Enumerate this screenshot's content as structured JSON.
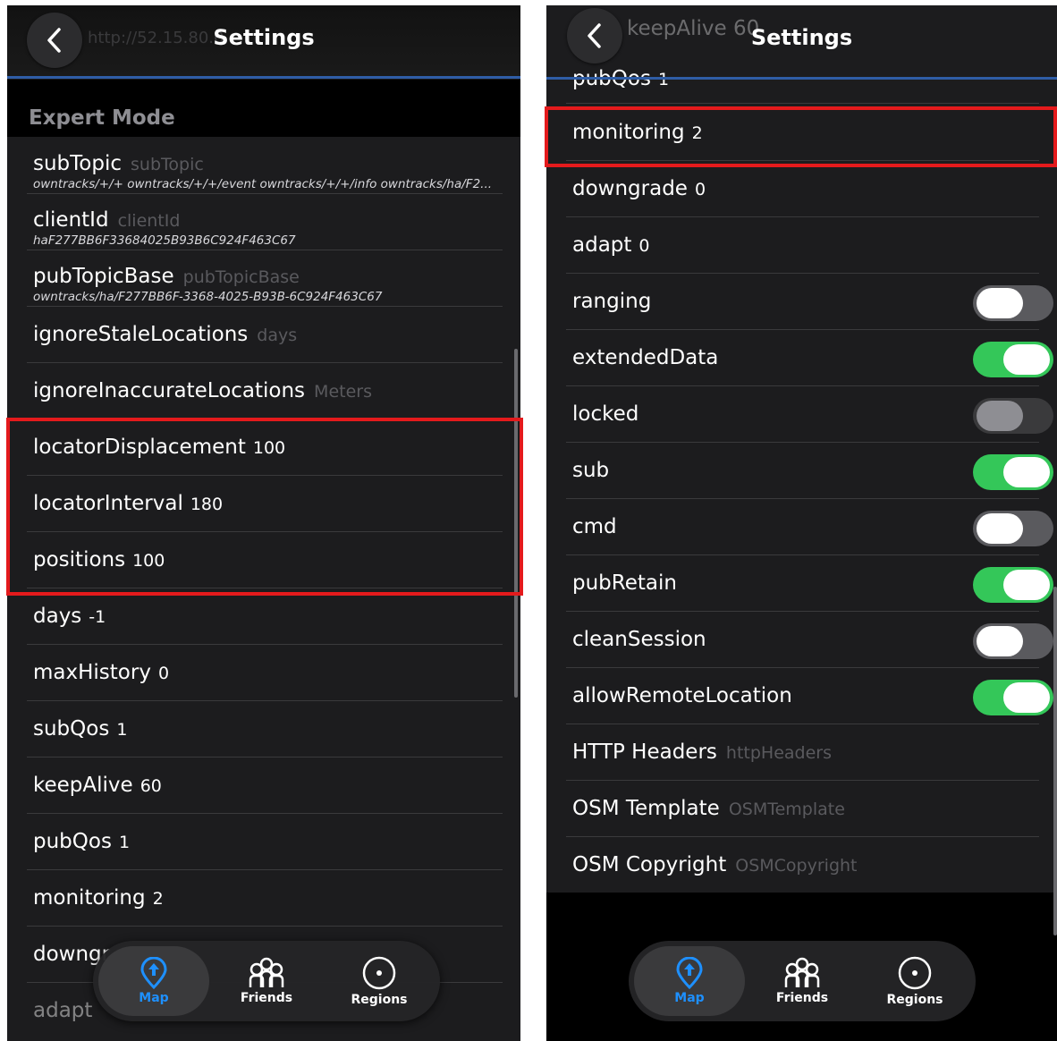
{
  "left": {
    "nav": {
      "title": "Settings",
      "ghost_text": "http://52.15.80.0"
    },
    "section_header": "Expert Mode",
    "rows": [
      {
        "label": "subTopic",
        "placeholder": "subTopic",
        "sub": "owntracks/+/+ owntracks/+/+/event owntracks/+/+/info owntracks/ha/F2..."
      },
      {
        "label": "clientId",
        "placeholder": "clientId",
        "sub": "haF277BB6F33684025B93B6C924F463C67"
      },
      {
        "label": "pubTopicBase",
        "placeholder": "pubTopicBase",
        "sub": "owntracks/ha/F277BB6F-3368-4025-B93B-6C924F463C67"
      },
      {
        "label": "ignoreStaleLocations",
        "placeholder": "days"
      },
      {
        "label": "ignoreInaccurateLocations",
        "placeholder": "Meters"
      },
      {
        "label": "locatorDisplacement",
        "value": "100"
      },
      {
        "label": "locatorInterval",
        "value": "180"
      },
      {
        "label": "positions",
        "value": "100"
      },
      {
        "label": "days",
        "value": "-1"
      },
      {
        "label": "maxHistory",
        "value": "0"
      },
      {
        "label": "subQos",
        "value": "1"
      },
      {
        "label": "keepAlive",
        "value": "60"
      },
      {
        "label": "pubQos",
        "value": "1"
      },
      {
        "label": "monitoring",
        "value": "2"
      },
      {
        "label": "downgr",
        "value": ""
      },
      {
        "label": "adapt",
        "value": ""
      }
    ],
    "tabs": [
      {
        "label": "Map",
        "icon": "map-pin-icon"
      },
      {
        "label": "Friends",
        "icon": "friends-icon"
      },
      {
        "label": "Regions",
        "icon": "regions-icon"
      }
    ]
  },
  "right": {
    "nav": {
      "title": "Settings",
      "ghost_text": "keepAlive 60"
    },
    "partial_row": {
      "label": "pubQos",
      "value": "1"
    },
    "rows": [
      {
        "label": "monitoring",
        "value": "2"
      },
      {
        "label": "downgrade",
        "value": "0"
      },
      {
        "label": "adapt",
        "value": "0"
      },
      {
        "label": "ranging",
        "toggle": "off"
      },
      {
        "label": "extendedData",
        "toggle": "on"
      },
      {
        "label": "locked",
        "toggle": "disabled"
      },
      {
        "label": "sub",
        "toggle": "on"
      },
      {
        "label": "cmd",
        "toggle": "off"
      },
      {
        "label": "pubRetain",
        "toggle": "on"
      },
      {
        "label": "cleanSession",
        "toggle": "off"
      },
      {
        "label": "allowRemoteLocation",
        "toggle": "on"
      },
      {
        "label": "HTTP Headers",
        "placeholder": "httpHeaders"
      },
      {
        "label": "OSM Template",
        "placeholder": "OSMTemplate"
      },
      {
        "label": "OSM Copyright",
        "placeholder": "OSMCopyright"
      }
    ],
    "tabs": [
      {
        "label": "Map",
        "icon": "map-pin-icon"
      },
      {
        "label": "Friends",
        "icon": "friends-icon"
      },
      {
        "label": "Regions",
        "icon": "regions-icon"
      }
    ]
  },
  "colors": {
    "accent": "#1e90ff",
    "highlight": "#e41a1c",
    "toggle_on": "#34c759",
    "divider": "#2f5da6"
  }
}
